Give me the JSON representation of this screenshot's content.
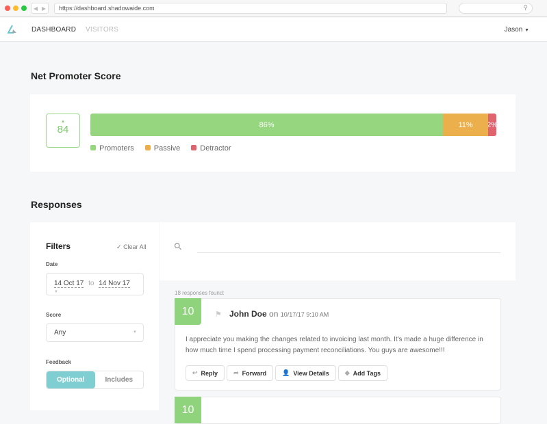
{
  "browser": {
    "url": "https://dashboard.shadowaide.com"
  },
  "nav": {
    "items": [
      "DASHBOARD",
      "VISITORS"
    ],
    "user": "Jason"
  },
  "nps": {
    "title": "Net Promoter Score",
    "score": "84",
    "segments": [
      {
        "label": "86%",
        "value": 86,
        "color": "#95d67f"
      },
      {
        "label": "11%",
        "value": 11,
        "color": "#ebb04c"
      },
      {
        "label": "2%",
        "value": 2,
        "color": "#e0646f"
      }
    ],
    "legend": [
      "Promoters",
      "Passive",
      "Detractor"
    ]
  },
  "responses": {
    "title": "Responses",
    "count_text": "18 responses found:",
    "filters": {
      "title": "Filters",
      "clear": "Clear All",
      "date_label": "Date",
      "date_from": "14 Oct 17",
      "date_to_word": "to",
      "date_to": "14 Nov 17",
      "score_label": "Score",
      "score_value": "Any",
      "feedback_label": "Feedback",
      "feedback_options": [
        "Optional",
        "Includes"
      ]
    },
    "items": [
      {
        "score": "10",
        "name": "John Doe",
        "on": "on",
        "date": "10/17/17 9:10 AM",
        "text": "I appreciate you making the changes related to invoicing last month. It's made a huge difference in how much time I spend processing payment reconciliations. You guys are awesome!!!",
        "actions": [
          "Reply",
          "Forward",
          "View Details",
          "Add Tags"
        ]
      },
      {
        "score": "10"
      }
    ]
  }
}
